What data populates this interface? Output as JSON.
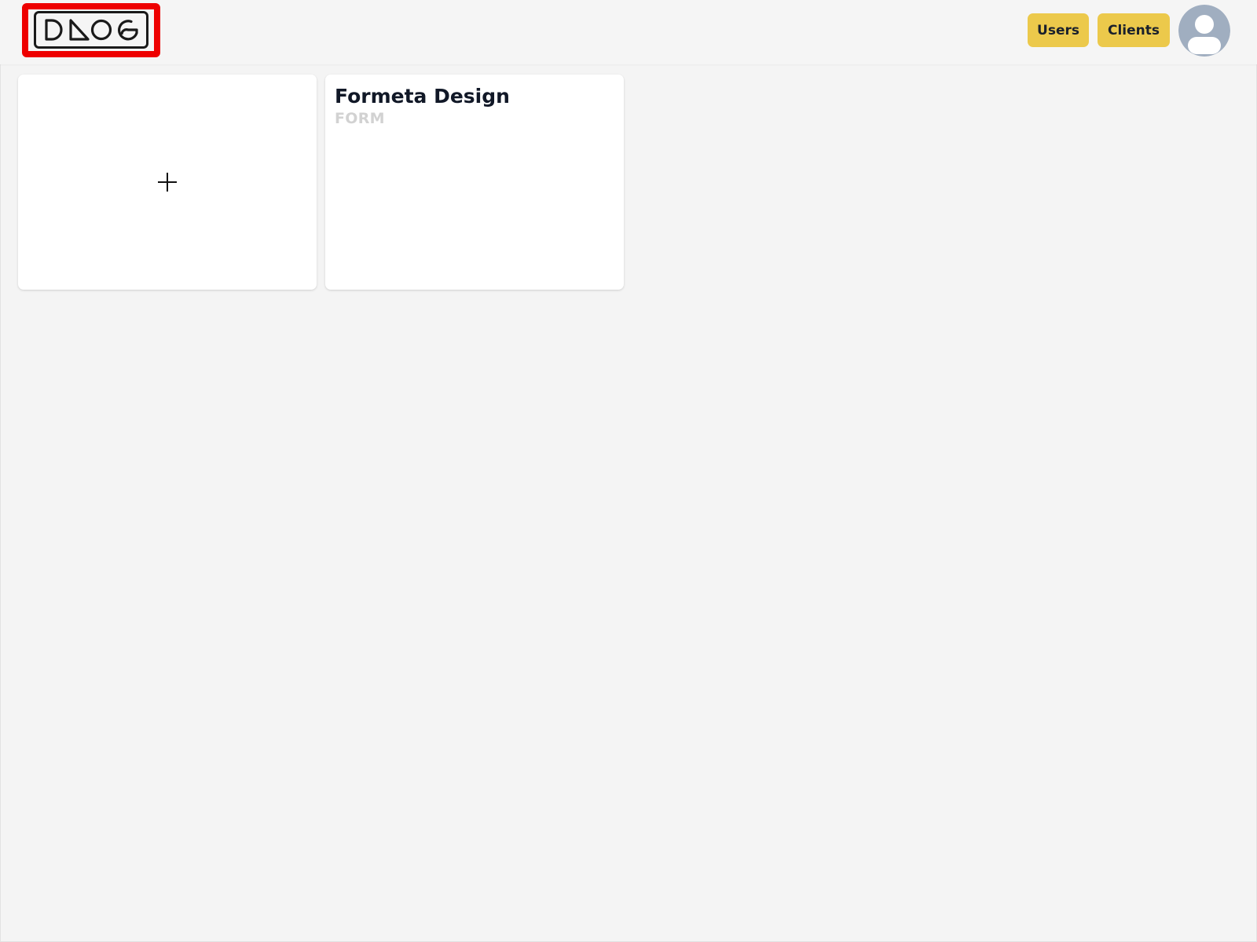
{
  "header": {
    "logo_text": "DAOG",
    "nav": [
      {
        "label": "Users"
      },
      {
        "label": "Clients"
      }
    ],
    "accent_color": "#ecc94b",
    "highlight_color": "#ee0000"
  },
  "cards": {
    "add_card": {
      "icon": "plus-icon"
    },
    "projects": [
      {
        "title": "Formeta Design",
        "type": "FORM"
      }
    ]
  },
  "icons": {
    "avatar": "user-avatar-icon",
    "add": "plus-icon"
  }
}
